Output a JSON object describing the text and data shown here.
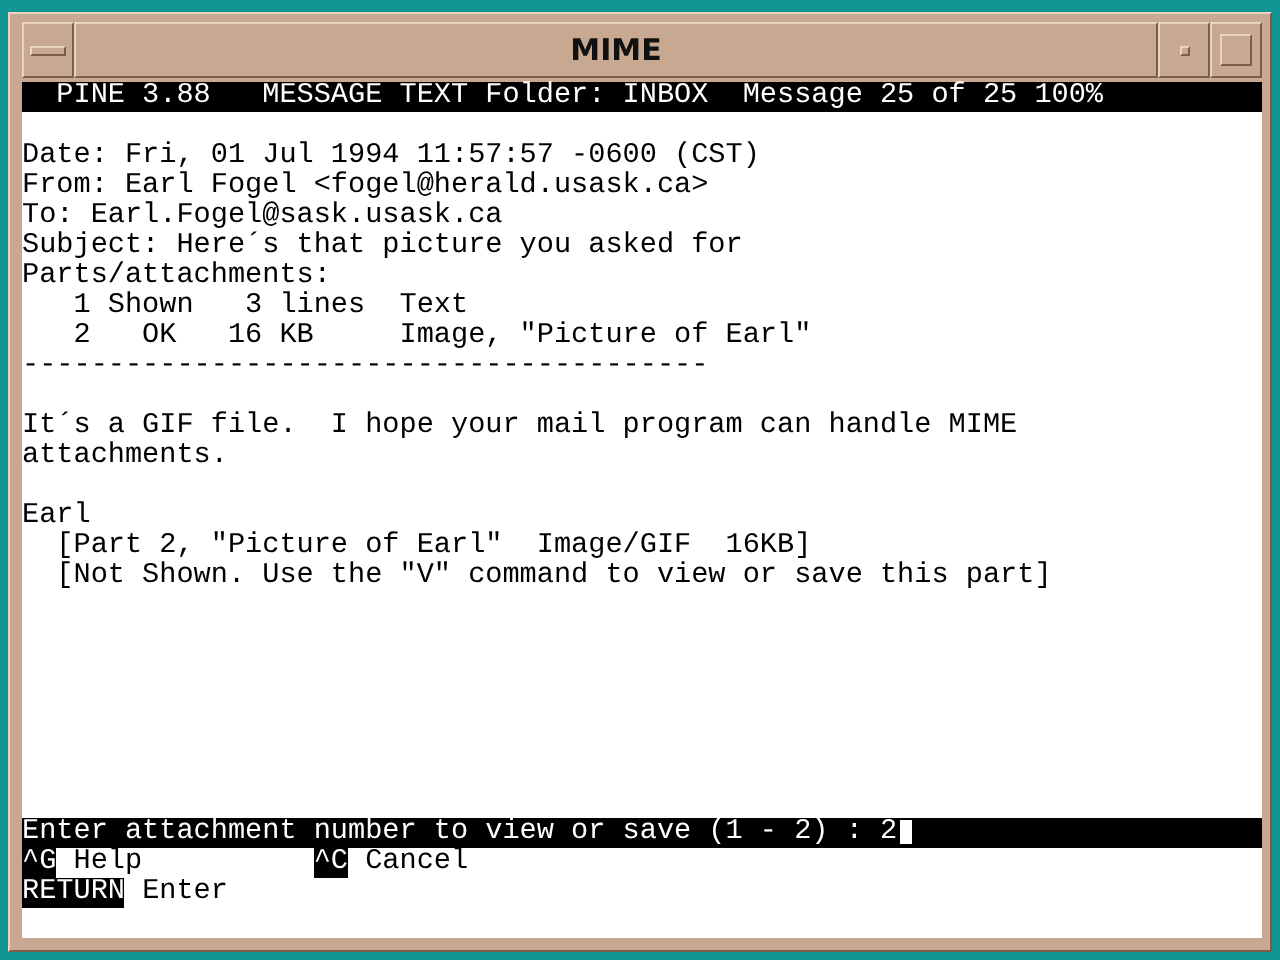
{
  "window": {
    "title": "MIME"
  },
  "status_bar": {
    "program": "PINE 3.88",
    "screen": "MESSAGE TEXT",
    "folder": "Folder: INBOX",
    "position": "Message 25 of 25 100%"
  },
  "headers": [
    "Date: Fri, 01 Jul 1994 11:57:57 -0600 (CST)",
    "From: Earl Fogel <fogel@herald.usask.ca>",
    "To: Earl.Fogel@sask.usask.ca",
    "Subject: Here´s that picture you asked for"
  ],
  "parts_heading": "Parts/attachments:",
  "parts": [
    "   1 Shown   3 lines  Text",
    "   2   OK   16 KB     Image, \"Picture of Earl\""
  ],
  "separator": "----------------------------------------",
  "body": [
    [
      "It´s a GIF file.  I hope your mail program can handle MIME",
      "attachments."
    ],
    [
      "Earl",
      "  [Part 2, \"Picture of Earl\"  Image/GIF  16KB]",
      "  [Not Shown. Use the \"V\" command to view or save this part]"
    ]
  ],
  "prompt": {
    "text": "Enter attachment number to view or save (1 - 2) : ",
    "value": "2"
  },
  "key_rows": [
    [
      {
        "key": "^G",
        "label": "Help"
      },
      {
        "key": "^C",
        "label": "Cancel"
      }
    ],
    [
      {
        "key": "RETURN",
        "label": "Enter"
      }
    ]
  ]
}
